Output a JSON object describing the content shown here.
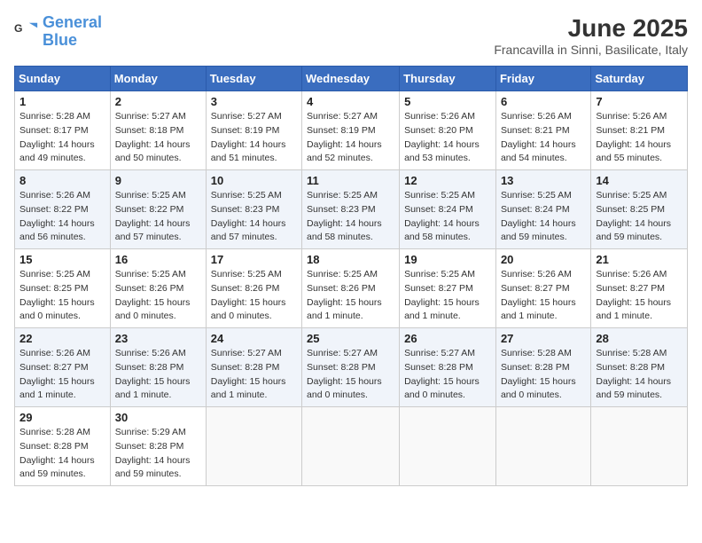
{
  "logo": {
    "line1": "General",
    "line2": "Blue"
  },
  "title": "June 2025",
  "location": "Francavilla in Sinni, Basilicate, Italy",
  "weekdays": [
    "Sunday",
    "Monday",
    "Tuesday",
    "Wednesday",
    "Thursday",
    "Friday",
    "Saturday"
  ],
  "weeks": [
    [
      {
        "day": "1",
        "info": "Sunrise: 5:28 AM\nSunset: 8:17 PM\nDaylight: 14 hours\nand 49 minutes."
      },
      {
        "day": "2",
        "info": "Sunrise: 5:27 AM\nSunset: 8:18 PM\nDaylight: 14 hours\nand 50 minutes."
      },
      {
        "day": "3",
        "info": "Sunrise: 5:27 AM\nSunset: 8:19 PM\nDaylight: 14 hours\nand 51 minutes."
      },
      {
        "day": "4",
        "info": "Sunrise: 5:27 AM\nSunset: 8:19 PM\nDaylight: 14 hours\nand 52 minutes."
      },
      {
        "day": "5",
        "info": "Sunrise: 5:26 AM\nSunset: 8:20 PM\nDaylight: 14 hours\nand 53 minutes."
      },
      {
        "day": "6",
        "info": "Sunrise: 5:26 AM\nSunset: 8:21 PM\nDaylight: 14 hours\nand 54 minutes."
      },
      {
        "day": "7",
        "info": "Sunrise: 5:26 AM\nSunset: 8:21 PM\nDaylight: 14 hours\nand 55 minutes."
      }
    ],
    [
      {
        "day": "8",
        "info": "Sunrise: 5:26 AM\nSunset: 8:22 PM\nDaylight: 14 hours\nand 56 minutes."
      },
      {
        "day": "9",
        "info": "Sunrise: 5:25 AM\nSunset: 8:22 PM\nDaylight: 14 hours\nand 57 minutes."
      },
      {
        "day": "10",
        "info": "Sunrise: 5:25 AM\nSunset: 8:23 PM\nDaylight: 14 hours\nand 57 minutes."
      },
      {
        "day": "11",
        "info": "Sunrise: 5:25 AM\nSunset: 8:23 PM\nDaylight: 14 hours\nand 58 minutes."
      },
      {
        "day": "12",
        "info": "Sunrise: 5:25 AM\nSunset: 8:24 PM\nDaylight: 14 hours\nand 58 minutes."
      },
      {
        "day": "13",
        "info": "Sunrise: 5:25 AM\nSunset: 8:24 PM\nDaylight: 14 hours\nand 59 minutes."
      },
      {
        "day": "14",
        "info": "Sunrise: 5:25 AM\nSunset: 8:25 PM\nDaylight: 14 hours\nand 59 minutes."
      }
    ],
    [
      {
        "day": "15",
        "info": "Sunrise: 5:25 AM\nSunset: 8:25 PM\nDaylight: 15 hours\nand 0 minutes."
      },
      {
        "day": "16",
        "info": "Sunrise: 5:25 AM\nSunset: 8:26 PM\nDaylight: 15 hours\nand 0 minutes."
      },
      {
        "day": "17",
        "info": "Sunrise: 5:25 AM\nSunset: 8:26 PM\nDaylight: 15 hours\nand 0 minutes."
      },
      {
        "day": "18",
        "info": "Sunrise: 5:25 AM\nSunset: 8:26 PM\nDaylight: 15 hours\nand 1 minute."
      },
      {
        "day": "19",
        "info": "Sunrise: 5:25 AM\nSunset: 8:27 PM\nDaylight: 15 hours\nand 1 minute."
      },
      {
        "day": "20",
        "info": "Sunrise: 5:26 AM\nSunset: 8:27 PM\nDaylight: 15 hours\nand 1 minute."
      },
      {
        "day": "21",
        "info": "Sunrise: 5:26 AM\nSunset: 8:27 PM\nDaylight: 15 hours\nand 1 minute."
      }
    ],
    [
      {
        "day": "22",
        "info": "Sunrise: 5:26 AM\nSunset: 8:27 PM\nDaylight: 15 hours\nand 1 minute."
      },
      {
        "day": "23",
        "info": "Sunrise: 5:26 AM\nSunset: 8:28 PM\nDaylight: 15 hours\nand 1 minute."
      },
      {
        "day": "24",
        "info": "Sunrise: 5:27 AM\nSunset: 8:28 PM\nDaylight: 15 hours\nand 1 minute."
      },
      {
        "day": "25",
        "info": "Sunrise: 5:27 AM\nSunset: 8:28 PM\nDaylight: 15 hours\nand 0 minutes."
      },
      {
        "day": "26",
        "info": "Sunrise: 5:27 AM\nSunset: 8:28 PM\nDaylight: 15 hours\nand 0 minutes."
      },
      {
        "day": "27",
        "info": "Sunrise: 5:28 AM\nSunset: 8:28 PM\nDaylight: 15 hours\nand 0 minutes."
      },
      {
        "day": "28",
        "info": "Sunrise: 5:28 AM\nSunset: 8:28 PM\nDaylight: 14 hours\nand 59 minutes."
      }
    ],
    [
      {
        "day": "29",
        "info": "Sunrise: 5:28 AM\nSunset: 8:28 PM\nDaylight: 14 hours\nand 59 minutes."
      },
      {
        "day": "30",
        "info": "Sunrise: 5:29 AM\nSunset: 8:28 PM\nDaylight: 14 hours\nand 59 minutes."
      },
      null,
      null,
      null,
      null,
      null
    ]
  ]
}
